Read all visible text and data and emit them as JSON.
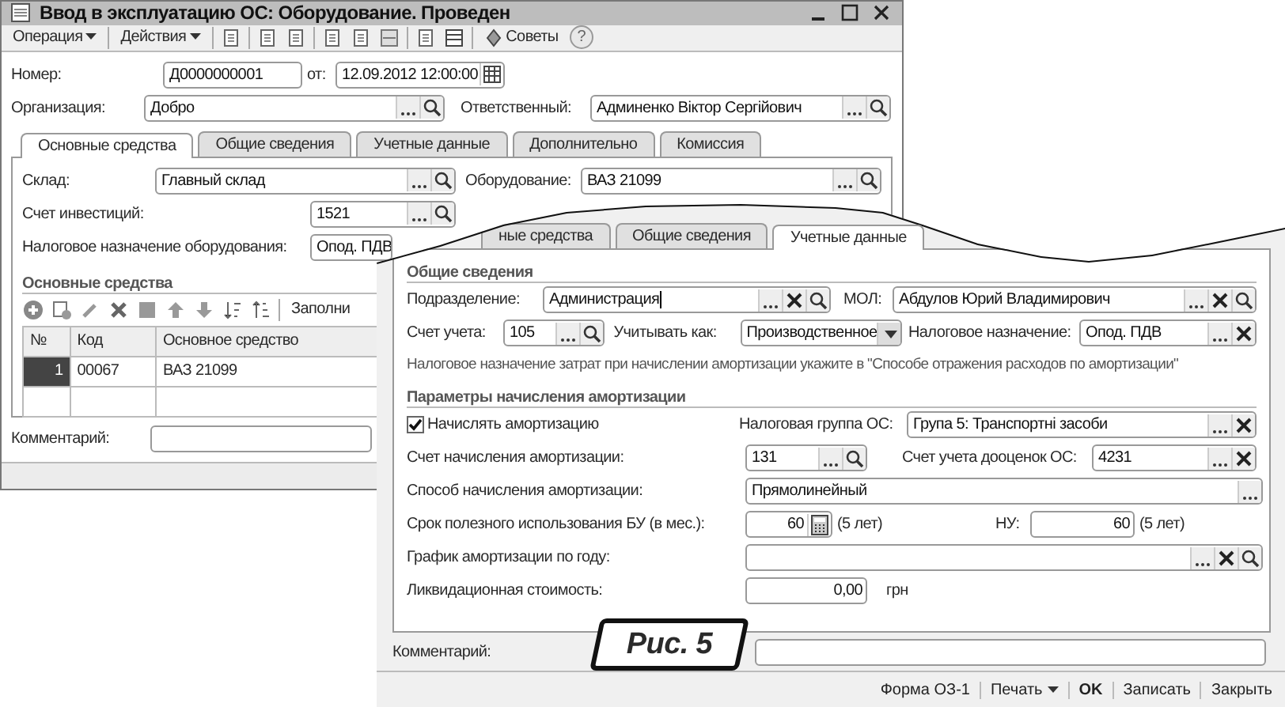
{
  "window": {
    "title": "Ввод в эксплуатацию ОС: Оборудование. Проведен"
  },
  "toolbar": {
    "menus": [
      "Операция",
      "Действия"
    ],
    "tips": "Советы",
    "help": "?"
  },
  "header": {
    "number_label": "Номер:",
    "number": "Д0000000001",
    "date_label": "от:",
    "date": "12.09.2012 12:00:00",
    "org_label": "Организация:",
    "org": "Добро",
    "resp_label": "Ответственный:",
    "resp": "Админенко Віктор Сергійович"
  },
  "tabs": [
    {
      "label": "Основные средства",
      "selected": true
    },
    {
      "label": "Общие сведения",
      "selected": false
    },
    {
      "label": "Учетные данные",
      "selected": false
    },
    {
      "label": "Дополнительно",
      "selected": false
    },
    {
      "label": "Комиссия",
      "selected": false
    }
  ],
  "main_tab": {
    "warehouse_label": "Склад:",
    "warehouse": "Главный склад",
    "equipment_label": "Оборудование:",
    "equipment": "ВАЗ 21099",
    "invest_label": "Счет инвестиций:",
    "invest": "1521",
    "tax_label": "Налоговое назначение оборудования:",
    "tax": "Опод. ПДВ",
    "section": "Основные средства",
    "fill_button": "Заполни",
    "table": {
      "columns": [
        "№",
        "Код",
        "Основное средство"
      ],
      "rows": [
        {
          "cells": [
            "1",
            "00067",
            "ВАЗ 21099"
          ],
          "selected": true
        }
      ]
    }
  },
  "comment_label": "Комментарий:",
  "detail": {
    "tabs": [
      {
        "label": "ные средства",
        "selected": false
      },
      {
        "label": "Общие сведения",
        "selected": false
      },
      {
        "label": "Учетные данные",
        "selected": true
      }
    ],
    "section_general": "Общие сведения",
    "department_label": "Подразделение:",
    "department": "Администрация",
    "mol_label": "МОЛ:",
    "mol": "Абдулов Юрий Владимирович",
    "account_label": "Счет учета:",
    "account": "105",
    "treat_label": "Учитывать как:",
    "treat": "Производственное",
    "tax_label": "Налоговое назначение:",
    "tax": "Опод. ПДВ",
    "note": "Налоговое назначение затрат при начислении амортизации укажите в \"Способе отражения расходов по амортизации\"",
    "section_depr": "Параметры начисления амортизации",
    "accrue": {
      "label": "Начислять амортизацию",
      "checked": true
    },
    "tax_group_label": "Налоговая группа ОС:",
    "tax_group": "Група 5: Транспортні засоби",
    "depr_account_label": "Счет начисления амортизации:",
    "depr_account": "131",
    "reval_label": "Счет учета дооценок ОС:",
    "reval": "4231",
    "method_label": "Способ начисления амортизации:",
    "method": "Прямолинейный",
    "life_label": "Срок полезного использования БУ (в мес.):",
    "life": "60",
    "life_years": "(5 лет)",
    "nu_label": "НУ:",
    "nu": "60",
    "nu_years": "(5 лет)",
    "schedule_label": "График  амортизации по году:",
    "salvage_label": "Ликвидационная стоимость:",
    "salvage": "0,00",
    "currency": "грн",
    "comment_label": "Комментарий:",
    "footer": [
      "Форма ОЗ-1",
      "Печать",
      "OK",
      "Записать",
      "Закрыть"
    ]
  },
  "figure_label": "Рис. 5"
}
